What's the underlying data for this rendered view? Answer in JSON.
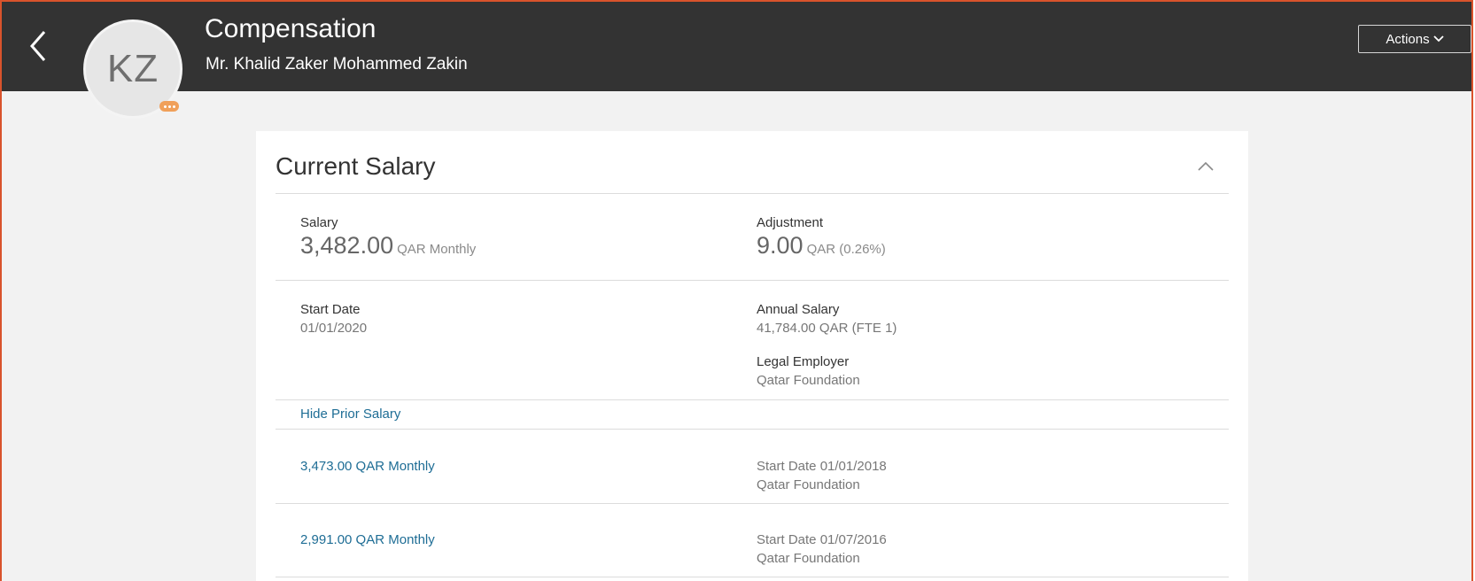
{
  "header": {
    "title": "Compensation",
    "person_name": "Mr. Khalid Zaker Mohammed Zakin",
    "avatar_initials": "KZ",
    "actions_label": "Actions",
    "back_icon": "chevron-left-icon",
    "actions_icon": "chevron-down-icon"
  },
  "colors": {
    "header_bg": "#333333",
    "page_bg": "#f2f2f2",
    "link": "#1e6d95",
    "frame_border": "#d9532c",
    "badge": "#f0a05a"
  },
  "card": {
    "title": "Current Salary",
    "collapse_icon": "chevron-up-icon",
    "salary": {
      "label": "Salary",
      "value": "3,482.00",
      "unit": "QAR Monthly"
    },
    "adjustment": {
      "label": "Adjustment",
      "value": "9.00",
      "unit": "QAR (0.26%)"
    },
    "start_date": {
      "label": "Start Date",
      "value": "01/01/2020"
    },
    "annual_salary": {
      "label": "Annual Salary",
      "value": "41,784.00 QAR (FTE 1)"
    },
    "legal_employer": {
      "label": "Legal Employer",
      "value": "Qatar Foundation"
    },
    "hide_prior_label": "Hide Prior Salary",
    "prior_salaries": [
      {
        "amount": "3,473.00 QAR Monthly",
        "start_date": "Start Date 01/01/2018",
        "employer": "Qatar Foundation"
      },
      {
        "amount": "2,991.00 QAR Monthly",
        "start_date": "Start Date 01/07/2016",
        "employer": "Qatar Foundation"
      }
    ]
  }
}
